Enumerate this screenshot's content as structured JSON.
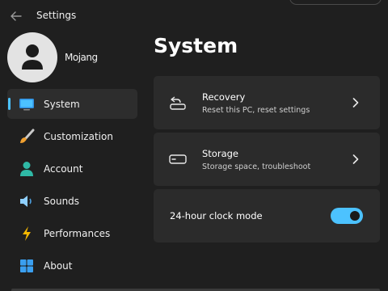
{
  "window": {
    "title": "Settings"
  },
  "user": {
    "name": "Mojang"
  },
  "sidebar": {
    "items": [
      {
        "label": "System",
        "icon": "monitor-icon",
        "active": true
      },
      {
        "label": "Customization",
        "icon": "paintbrush-icon",
        "active": false
      },
      {
        "label": "Account",
        "icon": "person-icon",
        "active": false
      },
      {
        "label": "Sounds",
        "icon": "speaker-icon",
        "active": false
      },
      {
        "label": "Performances",
        "icon": "lightning-icon",
        "active": false
      },
      {
        "label": "About",
        "icon": "windows-logo-icon",
        "active": false
      }
    ]
  },
  "main": {
    "title": "System",
    "cards": [
      {
        "title": "Recovery",
        "subtitle": "Reset this PC, reset settings",
        "icon": "recovery-icon"
      },
      {
        "title": "Storage",
        "subtitle": "Storage space, troubleshoot",
        "icon": "storage-drive-icon"
      }
    ],
    "toggle": {
      "label": "24-hour clock mode",
      "state": "on"
    }
  },
  "colors": {
    "background": "#1f1f1f",
    "card": "#2b2b2b",
    "accent": "#4cc2ff",
    "active_nav": "#2d2d2d"
  }
}
